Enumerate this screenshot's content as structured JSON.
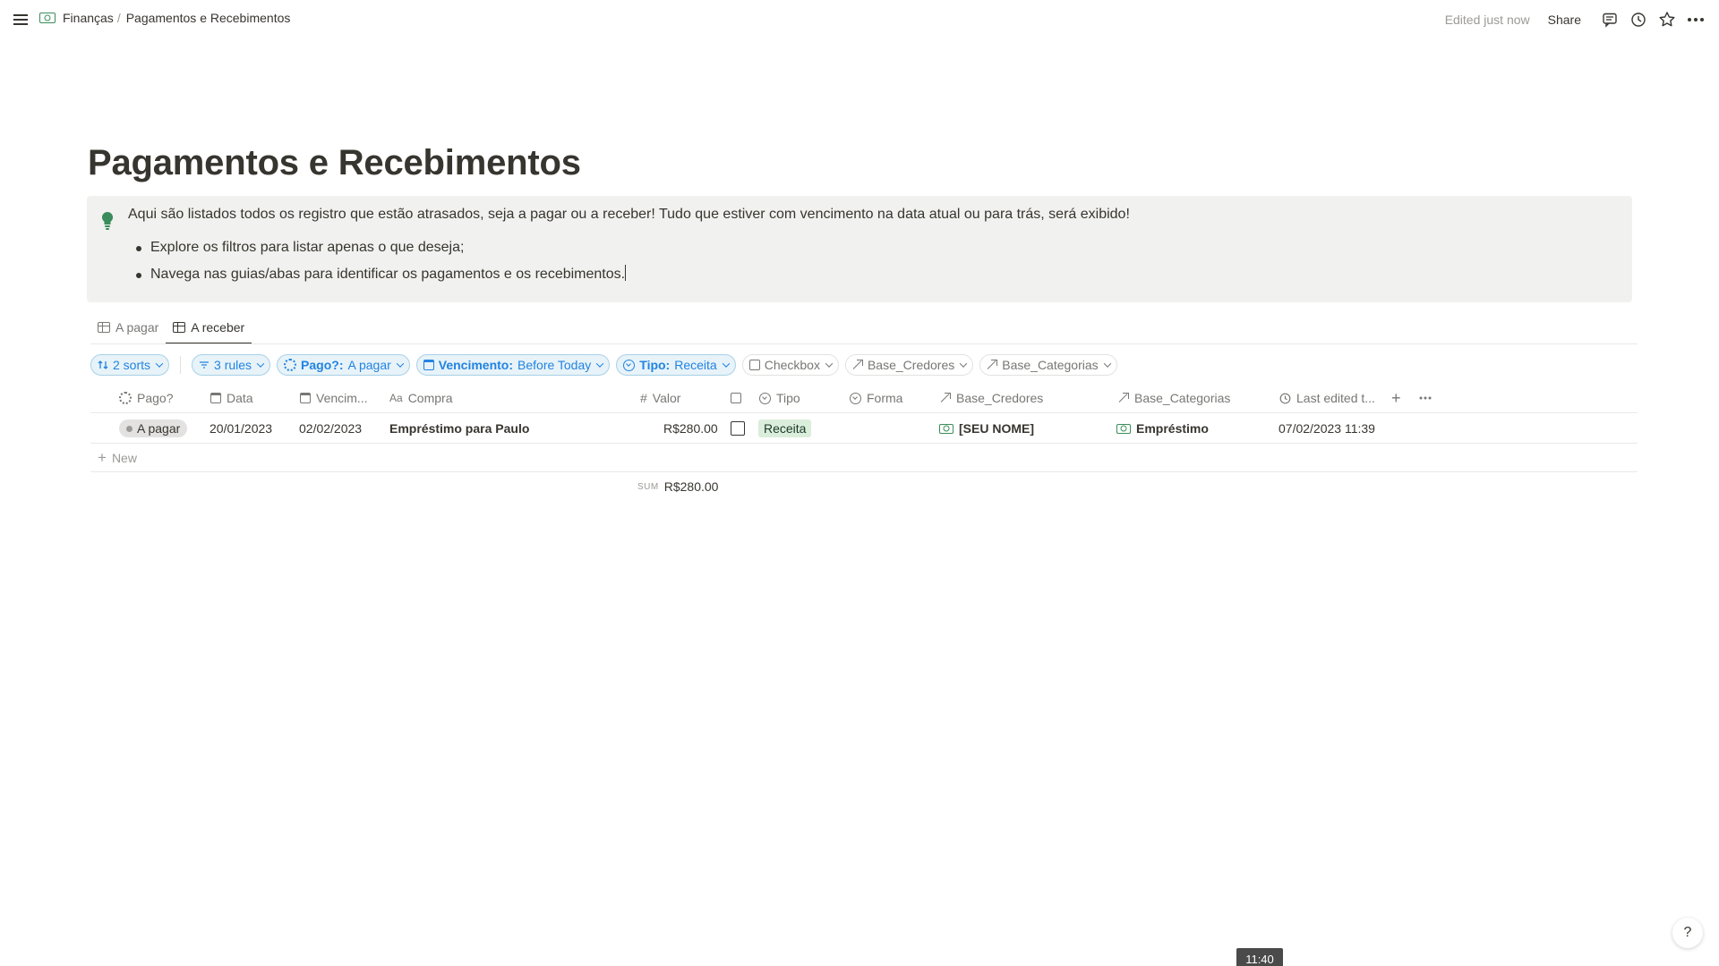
{
  "topbar": {
    "breadcrumb_root": "Finanças",
    "breadcrumb_sep": "/",
    "breadcrumb_page": "Pagamentos e Recebimentos",
    "edited": "Edited just now",
    "share": "Share"
  },
  "page": {
    "title": "Pagamentos e Recebimentos",
    "callout": {
      "text": "Aqui são listados todos os registro que estão atrasados, seja a pagar ou a receber! Tudo que estiver com vencimento na data atual ou para trás, será exibido!",
      "bullets": [
        "Explore os filtros para listar apenas o que deseja;",
        "Navega nas guias/abas para identificar os pagamentos e os recebimentos."
      ]
    }
  },
  "tabs": [
    {
      "label": "A pagar",
      "active": false
    },
    {
      "label": "A receber",
      "active": true
    }
  ],
  "filters": {
    "sorts": "2 sorts",
    "rules": "3 rules",
    "pago_key": "Pago?:",
    "pago_val": "A pagar",
    "venc_key": "Vencimento:",
    "venc_val": "Before Today",
    "tipo_key": "Tipo:",
    "tipo_val": "Receita",
    "checkbox": "Checkbox",
    "credores": "Base_Credores",
    "categorias": "Base_Categorias"
  },
  "table": {
    "columns": {
      "pago": "Pago?",
      "data": "Data",
      "venc": "Vencim...",
      "compra": "Compra",
      "valor": "Valor",
      "tipo": "Tipo",
      "forma": "Forma",
      "credores": "Base_Credores",
      "categorias": "Base_Categorias",
      "edited": "Last edited t...",
      "aa": "Aa",
      "hash": "#"
    },
    "rows": [
      {
        "pago": "A pagar",
        "data": "20/01/2023",
        "venc": "02/02/2023",
        "compra": "Empréstimo para Paulo",
        "valor": "R$280.00",
        "checked": false,
        "tipo": "Receita",
        "forma": "",
        "credores": "[SEU NOME]",
        "categorias": "Empréstimo",
        "edited": "07/02/2023 11:39"
      }
    ],
    "new_label": "New",
    "sum_label": "SUM",
    "sum_value": "R$280.00"
  },
  "help": "?",
  "time_tooltip": "11:40",
  "colors": {
    "accent": "#2383e2",
    "money_icon": "#3a8d5a",
    "tag_green_bg": "#dbeddb",
    "callout_bg": "#f1f1ef"
  }
}
